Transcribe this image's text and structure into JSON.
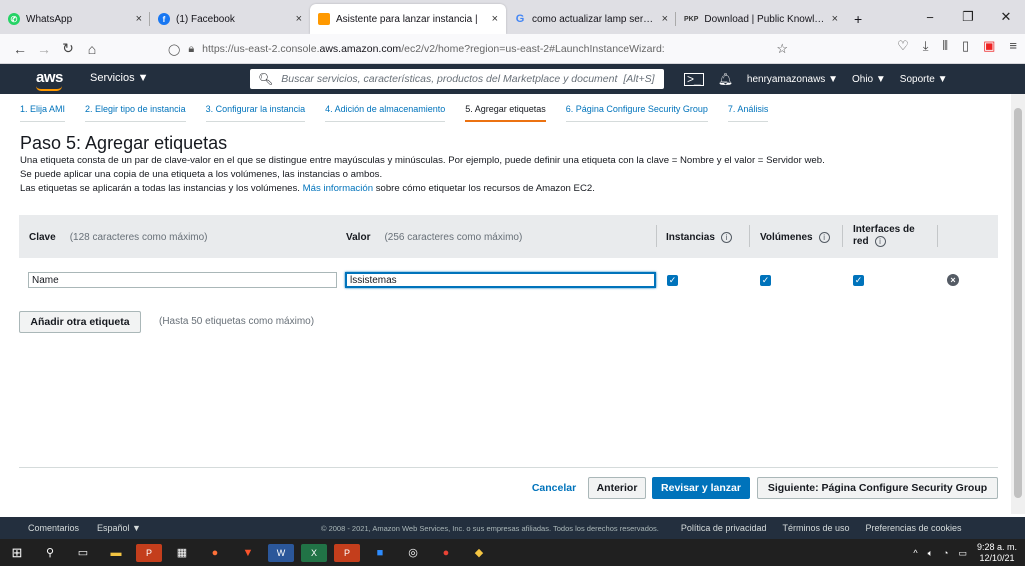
{
  "browser": {
    "tabs": [
      {
        "title": "WhatsApp",
        "icon": "whatsapp-icon",
        "color": "#25d366"
      },
      {
        "title": "(1) Facebook",
        "icon": "facebook-icon",
        "color": "#1877f2"
      },
      {
        "title": "Asistente para lanzar instancia |",
        "icon": "aws-icon",
        "color": "#ff9900"
      },
      {
        "title": "como actualizar lamp server - B",
        "icon": "google-icon",
        "color": "#4285f4"
      },
      {
        "title": "Download | Public Knowledge F",
        "icon": "pkp-icon",
        "color": "#333333",
        "badge": "PKP"
      }
    ],
    "new_tab": "+",
    "url_prefix": "https://us-east-2.console.",
    "url_domain": "aws.amazon.com",
    "url_suffix": "/ec2/v2/home?region=us-east-2#LaunchInstanceWizard:"
  },
  "aws": {
    "logo": "aws",
    "services": "Servicios ▼",
    "search_placeholder": "Buscar servicios, características, productos del Marketplace y document",
    "search_shortcut": "[Alt+S]",
    "user": "henryamazonaws ▼",
    "region": "Ohio ▼",
    "support": "Soporte ▼"
  },
  "steps": [
    "1. Elija AMI",
    "2. Elegir tipo de instancia",
    "3. Configurar la instancia",
    "4. Adición de almacenamiento",
    "5. Agregar etiquetas",
    "6. Página Configure Security Group",
    "7. Análisis"
  ],
  "current_step": 4,
  "page": {
    "title": "Paso 5: Agregar etiquetas",
    "desc1": "Una etiqueta consta de un par de clave-valor en el que se distingue entre mayúsculas y minúsculas. Por ejemplo, puede definir una etiqueta con la clave = Nombre y el valor = Servidor web.",
    "desc2": "Se puede aplicar una copia de una etiqueta a los volúmenes, las instancias o ambos.",
    "desc3_pre": "Las etiquetas se aplicarán a todas las instancias y los volúmenes.",
    "desc3_link": "Más información",
    "desc3_post": "sobre cómo etiquetar los recursos de Amazon EC2."
  },
  "table": {
    "col_key": "Clave",
    "col_key_hint": "(128 caracteres como máximo)",
    "col_value": "Valor",
    "col_value_hint": "(256 caracteres como máximo)",
    "col_instances": "Instancias",
    "col_volumes": "Volúmenes",
    "col_interfaces_1": "Interfaces de",
    "col_interfaces_2": "red",
    "row": {
      "key": "Name",
      "value": "lssistemas",
      "instances": true,
      "volumes": true,
      "interfaces": true
    }
  },
  "add_tag": {
    "label": "Añadir otra etiqueta",
    "note": "(Hasta 50 etiquetas como máximo)"
  },
  "actions": {
    "cancel": "Cancelar",
    "previous": "Anterior",
    "review": "Revisar y lanzar",
    "next": "Siguiente: Página Configure Security Group"
  },
  "footer": {
    "feedback": "Comentarios",
    "language": "Español ▼",
    "copyright": "© 2008 - 2021, Amazon Web Services, Inc. o sus empresas afiliadas. Todos los derechos reservados.",
    "privacy": "Política de privacidad",
    "terms": "Términos de uso",
    "cookies": "Preferencias de cookies"
  },
  "taskbar": {
    "time": "9:28 a. m.",
    "date": "12/10/21"
  }
}
